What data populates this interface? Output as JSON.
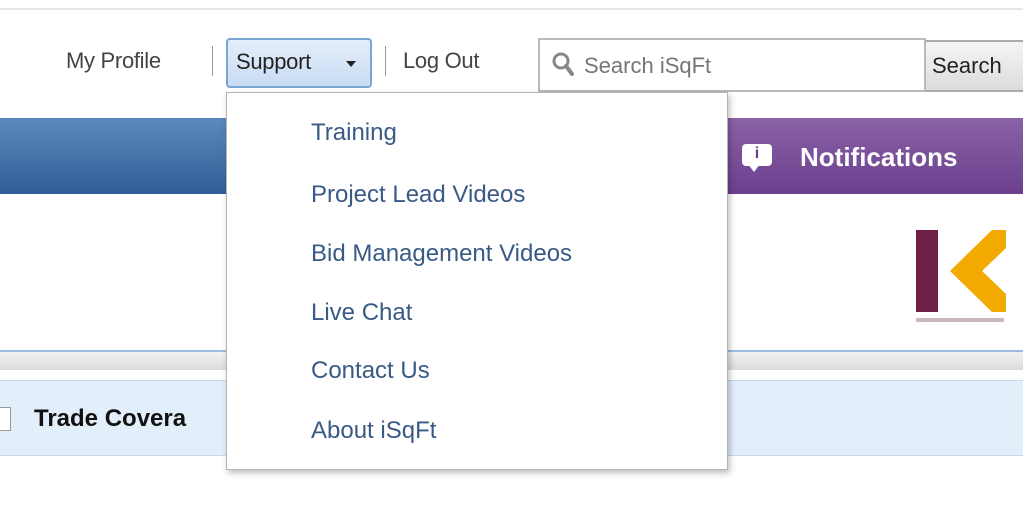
{
  "top_nav": {
    "my_profile": "My Profile",
    "support": "Support",
    "log_out": "Log Out"
  },
  "search": {
    "placeholder": "Search iSqFt",
    "button": "Search"
  },
  "header": {
    "notifications_label": "Notifications",
    "notifications_icon_glyph": "i"
  },
  "content": {
    "tab_label": "Trade Covera"
  },
  "support_menu": {
    "items": [
      "Training",
      "Project Lead Videos",
      "Bid Management Videos",
      "Live Chat",
      "Contact Us",
      "About iSqFt"
    ]
  },
  "colors": {
    "header_blue": "#2f5f96",
    "notifications_purple": "#6b3f8e",
    "menu_link": "#3a5a86",
    "logo_maroon": "#6d1f45",
    "logo_gold": "#f2a900"
  }
}
